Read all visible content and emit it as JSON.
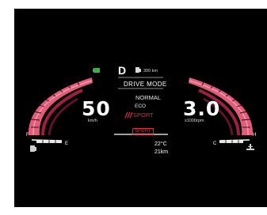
{
  "gear": "D",
  "range": "300 km",
  "drive_mode": {
    "title": "DRIVE MODE",
    "options": [
      "NORMAL",
      "ECO",
      "SPORT"
    ],
    "selected": "SPORT",
    "badge": "SPORT"
  },
  "speed": {
    "value": "50",
    "unit": "km/h"
  },
  "rpm": {
    "value": "3.0",
    "unit": "x1000rpm"
  },
  "fuel_gauge": {
    "full_label": "F",
    "empty_label": "E"
  },
  "temp_gauge": {
    "cold_label": "C",
    "hot_label": "H"
  },
  "outside_temp": "22°C",
  "trip_distance": "21km",
  "colors": {
    "accent": "#d6304a",
    "gauge": "#e35c7a",
    "indicator": "#3fae49"
  },
  "icons": [
    "battery-indicator-icon",
    "fuel-pump-icon",
    "fuel-gauge-icon",
    "coolant-temp-icon",
    "drive-mode-icon"
  ]
}
